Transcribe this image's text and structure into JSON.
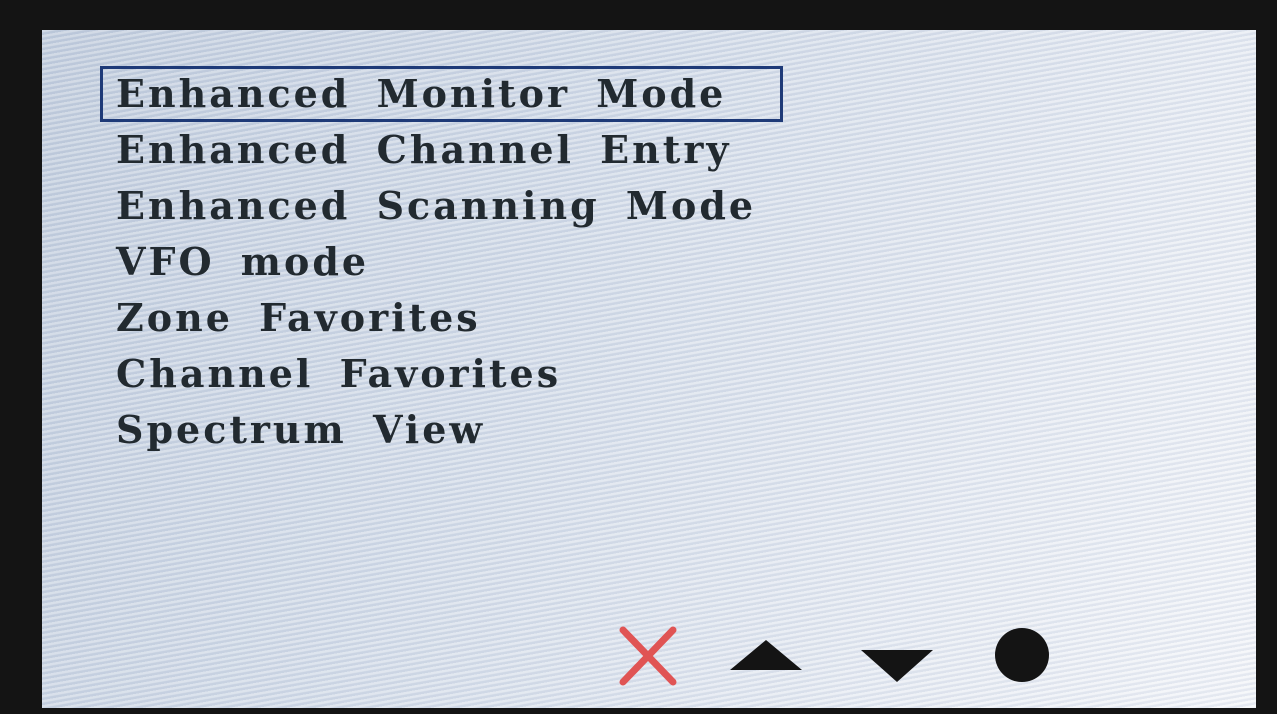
{
  "menu": {
    "items": [
      {
        "label": "Enhanced Monitor Mode",
        "selected": true
      },
      {
        "label": "Enhanced Channel Entry",
        "selected": false
      },
      {
        "label": "Enhanced Scanning Mode",
        "selected": false
      },
      {
        "label": "VFO mode",
        "selected": false
      },
      {
        "label": "Zone Favorites",
        "selected": false
      },
      {
        "label": "Channel Favorites",
        "selected": false
      },
      {
        "label": "Spectrum View",
        "selected": false
      }
    ]
  },
  "softkeys": {
    "cancel_icon": "close-icon",
    "up_icon": "triangle-up-icon",
    "down_icon": "triangle-down-icon",
    "ok_icon": "circle-icon"
  },
  "colors": {
    "selection_border": "#1e3a78",
    "cancel": "#e05454",
    "text": "#222a30",
    "icons": "#141414"
  }
}
